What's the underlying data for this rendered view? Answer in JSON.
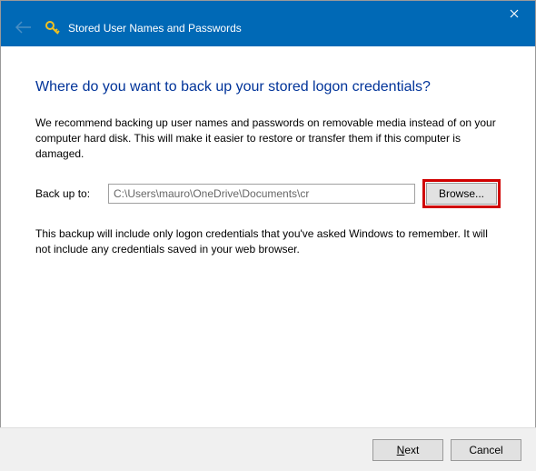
{
  "titlebar": {
    "title": "Stored User Names and Passwords"
  },
  "heading": "Where do you want to back up your stored logon credentials?",
  "paragraph1": "We recommend backing up user names and passwords on removable media instead of on your computer hard disk. This will make it easier to restore or transfer them if this computer is damaged.",
  "form": {
    "label": "Back up to:",
    "path_value": "C:\\Users\\mauro\\OneDrive\\Documents\\cr",
    "browse_label": "Browse..."
  },
  "paragraph2": "This backup will include only logon credentials that you've asked Windows to remember. It will not include any credentials saved in your web browser.",
  "footer": {
    "next_label": "Next",
    "cancel_label": "Cancel"
  }
}
